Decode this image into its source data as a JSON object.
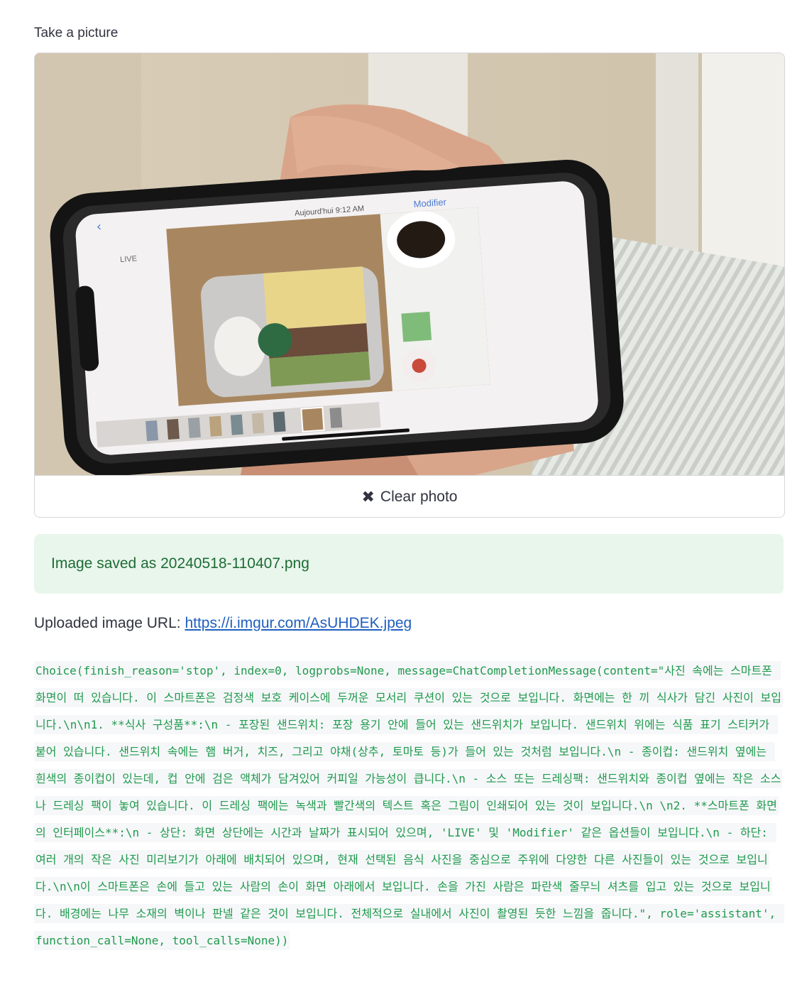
{
  "camera": {
    "label": "Take a picture",
    "clear_label": "Clear photo",
    "clear_icon": "close-icon",
    "phone_screen": {
      "time_label": "Aujourd'hui  9:12 AM",
      "edit_label": "Modifier",
      "live_label": "LIVE"
    }
  },
  "status": {
    "saved_message": "Image saved as 20240518-110407.png"
  },
  "upload": {
    "prefix": "Uploaded image URL: ",
    "url": "https://i.imgur.com/AsUHDEK.jpeg"
  },
  "output": {
    "text": "Choice(finish_reason='stop', index=0, logprobs=None, message=ChatCompletionMessage(content=\"사진 속에는 스마트폰 화면이 떠 있습니다. 이 스마트폰은 검정색 보호 케이스에 두꺼운 모서리 쿠션이 있는 것으로 보입니다. 화면에는 한 끼 식사가 담긴 사진이 보입니다.\\n\\n1. **식사 구성품**:\\n - 포장된 샌드위치: 포장 용기 안에 들어 있는 샌드위치가 보입니다. 샌드위치 위에는 식품 표기 스티커가 붙어 있습니다. 샌드위치 속에는 햄 버거, 치즈, 그리고 야채(상추, 토마토 등)가 들어 있는 것처럼 보입니다.\\n - 종이컵: 샌드위치 옆에는 흰색의 종이컵이 있는데, 컵 안에 검은 액체가 담겨있어 커피일 가능성이 큽니다.\\n - 소스 또는 드레싱팩: 샌드위치와 종이컵 옆에는 작은 소스나 드레싱 팩이 놓여 있습니다. 이 드레싱 팩에는 녹색과 빨간색의 텍스트 혹은 그림이 인쇄되어 있는 것이 보입니다.\\n \\n2. **스마트폰 화면의 인터페이스**:\\n - 상단: 화면 상단에는 시간과 날짜가 표시되어 있으며, 'LIVE' 및 'Modifier' 같은 옵션들이 보입니다.\\n - 하단: 여러 개의 작은 사진 미리보기가 아래에 배치되어 있으며, 현재 선택된 음식 사진을 중심으로 주위에 다양한 다른 사진들이 있는 것으로 보입니다.\\n\\n이 스마트폰은 손에 들고 있는 사람의 손이 화면 아래에서 보입니다. 손을 가진 사람은 파란색 줄무늬 셔츠를 입고 있는 것으로 보입니다. 배경에는 나무 소재의 벽이나 판넬 같은 것이 보입니다. 전체적으로 실내에서 사진이 촬영된 듯한 느낌을 줍니다.\", role='assistant', function_call=None, tool_calls=None))"
  },
  "colors": {
    "success_bg": "#e9f6ec",
    "success_text": "#1d6b35",
    "code_text": "#1f9a4d",
    "link": "#1f5fbf"
  }
}
